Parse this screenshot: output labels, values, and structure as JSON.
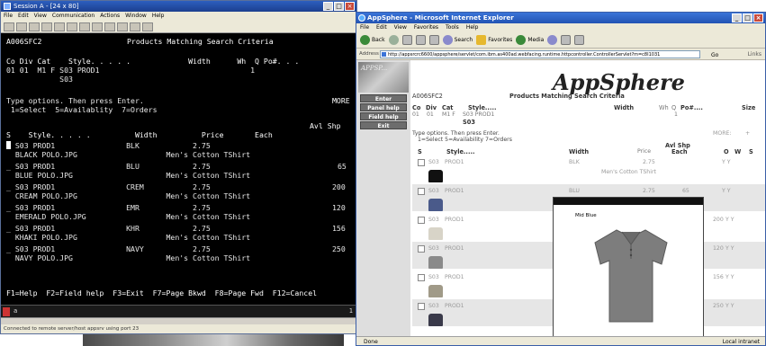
{
  "terminal": {
    "title": "Session A - [24 x 80]",
    "menu": [
      "File",
      "Edit",
      "View",
      "Communication",
      "Actions",
      "Window",
      "Help"
    ],
    "screen_id": "A006SFC2",
    "screen_title": "Products Matching Search Criteria",
    "header_labels": "Co Div Cat    Style. . . . .             Width      Wh  Q Po#. . .",
    "header_values": "01 01  M1 F S03 PROD1                                  1",
    "header_values2": "            S03",
    "instructions1": "Type options. Then press Enter.",
    "more": "MORE",
    "instructions2": " 1=Select  5=Availablity  7=Orders",
    "col_avl": "Avl Shp",
    "col_header": "S    Style. . . . .          Width          Price       Each",
    "rows": [
      {
        "line1": "  S03 PROD1                BLK            2.75",
        "line2": "  BLACK POLO.JPG                    Men's Cotton TShirt",
        "each": ""
      },
      {
        "line1": "_ S03 PROD1                BLU            2.75",
        "line2": "  BLUE POLO.JPG                     Men's Cotton TShirt",
        "each": "65"
      },
      {
        "line1": "_ S03 PROD1                CREM           2.75",
        "line2": "  CREAM POLO.JPG                    Men's Cotton TShirt",
        "each": "200"
      },
      {
        "line1": "_ S03 PROD1                EMR            2.75",
        "line2": "  EMERALD POLO.JPG                  Men's Cotton TShirt",
        "each": "120"
      },
      {
        "line1": "_ S03 PROD1                KHR            2.75",
        "line2": "  KHAKI POLO.JPG                    Men's Cotton TShirt",
        "each": "156"
      },
      {
        "line1": "_ S03 PROD1                NAVY           2.75",
        "line2": "  NAVY POLO.JPG                     Men's Cotton TShirt",
        "each": "250"
      }
    ],
    "fkeys": "F1=Help  F2=Field help  F3=Exit  F7=Page Bkwd  F8=Page Fwd  F12=Cancel",
    "status_pos": "a",
    "status_right": "1",
    "message": "Connected to remote server/host appsrv using port 23"
  },
  "ie": {
    "title": "AppSphere - Microsoft Internet Explorer",
    "menu": [
      "File",
      "Edit",
      "View",
      "Favorites",
      "Tools",
      "Help"
    ],
    "toolbar": {
      "back": "Back",
      "search": "Search",
      "favorites": "Favorites",
      "media": "Media"
    },
    "address_label": "Address",
    "address_url": "http://appsrcrc6600/appsphere/servlet/com.ibm.as400ad.webfacing.runtime.httpcontroller.ControllerServlet?m=c8I1031",
    "go_label": "Go",
    "links_label": "Links",
    "status": "Done",
    "zone": "Local intranet"
  },
  "app": {
    "logo_text": "APPSP...",
    "nav": [
      "Enter",
      "Panel help",
      "Field help",
      "Exit"
    ],
    "title": "AppSphere",
    "screen_id": "A006SFC2",
    "screen_title": "Products Matching Search Criteria",
    "hdr": {
      "co": "Co",
      "div": "Div",
      "cat": "Cat",
      "style": "Style.....",
      "width": "Width",
      "wh": "Wh",
      "q": "Q",
      "po": "Po#....",
      "size": "Size"
    },
    "hdr_vals": {
      "co": "01",
      "div": "01",
      "cat": "M1  F",
      "style": "S03  PROD1",
      "style2": "S03",
      "q": "1"
    },
    "instructions1": "Type options. Then press Enter.",
    "instructions2": "1=Select      5=Availability      7=Orders",
    "more": "MORE:",
    "more_sign": "+",
    "cols": {
      "s": "S",
      "style": "Style.....",
      "width": "Width",
      "price": "Price",
      "avl": "Avl Shp",
      "each": "Each",
      "o": "O",
      "w": "W",
      "s2": "S"
    },
    "rows": [
      {
        "style": "S03",
        "prod": "PROD1",
        "width": "BLK",
        "price": "2.75",
        "each": "",
        "ow": "Y  Y",
        "desc": "Men's Cotton TShirt",
        "color": "#111111"
      },
      {
        "style": "S03",
        "prod": "PROD1",
        "width": "BLU",
        "price": "2.75",
        "each": "65",
        "ow": "Y  Y",
        "desc": "",
        "color": "#4a5a8a"
      },
      {
        "style": "S03",
        "prod": "PROD1",
        "width": "",
        "price": "",
        "each": "200",
        "ow": "Y  Y",
        "desc": "",
        "color": "#d8d4c8"
      },
      {
        "style": "S03",
        "prod": "PROD1",
        "width": "",
        "price": "",
        "each": "120",
        "ow": "Y  Y",
        "desc": "",
        "color": "#8a8a8a"
      },
      {
        "style": "S03",
        "prod": "PROD1",
        "width": "",
        "price": "",
        "each": "156",
        "ow": "Y  Y",
        "desc": "",
        "color": "#a09a88"
      },
      {
        "style": "S03",
        "prod": "PROD1",
        "width": "",
        "price": "",
        "each": "250",
        "ow": "Y  Y",
        "desc": "",
        "color": "#3a3a4a"
      }
    ],
    "popup_caption": "Mid Blue",
    "popup_shirt_color": "#7d7d7d"
  }
}
